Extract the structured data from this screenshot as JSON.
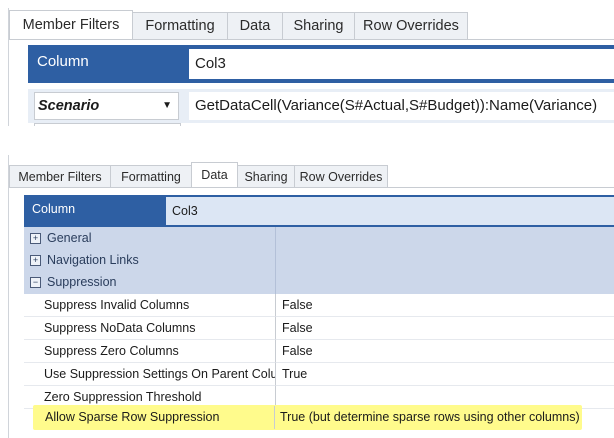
{
  "top": {
    "tabs": [
      "Member Filters",
      "Formatting",
      "Data",
      "Sharing",
      "Row Overrides"
    ],
    "column_label": "Column",
    "column_value": "Col3",
    "scenario_label": "Scenario",
    "formula": "GetDataCell(Variance(S#Actual,S#Budget)):Name(Variance)"
  },
  "bottom": {
    "tabs": [
      "Member Filters",
      "Formatting",
      "Data",
      "Sharing",
      "Row Overrides"
    ],
    "active_tab": "Data",
    "column_label": "Column",
    "column_value": "Col3",
    "categories": {
      "general": "General",
      "navigation_links": "Navigation Links",
      "suppression": "Suppression"
    },
    "expanders": {
      "collapsed": "+",
      "expanded": "−"
    },
    "properties": [
      {
        "name": "Suppress Invalid Columns",
        "value": "False"
      },
      {
        "name": "Suppress NoData Columns",
        "value": "False"
      },
      {
        "name": "Suppress Zero Columns",
        "value": "False"
      },
      {
        "name": "Use Suppression Settings On Parent Colur",
        "value": "True"
      },
      {
        "name": "Zero Suppression Threshold",
        "value": ""
      },
      {
        "name": "Allow Sparse Row Suppression",
        "value": "True (but determine sparse rows using other columns)"
      }
    ]
  },
  "colors": {
    "header_blue": "#2e5fa3",
    "highlight_yellow": "#fffb8c",
    "category_bg": "#ccd7ea"
  }
}
